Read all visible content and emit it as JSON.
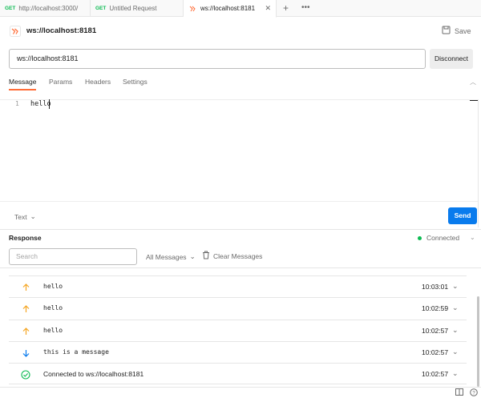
{
  "tabs": [
    {
      "method": "GET",
      "label": "http://localhost:3000/"
    },
    {
      "method": "GET",
      "label": "Untitled Request"
    },
    {
      "method": "",
      "label": "ws://localhost:8181",
      "active": true
    }
  ],
  "header": {
    "title": "ws://localhost:8181",
    "save_label": "Save"
  },
  "url": {
    "value": "ws://localhost:8181",
    "action_label": "Disconnect"
  },
  "subtabs": [
    "Message",
    "Params",
    "Headers",
    "Settings"
  ],
  "editor": {
    "line_number": "1",
    "content": "hello",
    "format": "Text",
    "send_label": "Send"
  },
  "response": {
    "title": "Response",
    "status": "Connected",
    "search_placeholder": "Search",
    "filter_label": "All Messages",
    "clear_label": "Clear Messages",
    "messages": [
      {
        "direction": "sent",
        "text": "hello",
        "time": "10:03:01"
      },
      {
        "direction": "sent",
        "text": "hello",
        "time": "10:02:59"
      },
      {
        "direction": "sent",
        "text": "hello",
        "time": "10:02:57"
      },
      {
        "direction": "received",
        "text": "this is a message",
        "time": "10:02:57"
      },
      {
        "direction": "connected",
        "text": "Connected to ws://localhost:8181",
        "time": "10:02:57"
      }
    ]
  },
  "colors": {
    "accent": "#ff6c37",
    "primary": "#097bed",
    "success": "#0cbb52",
    "sent": "#f5a623",
    "received": "#097bed"
  }
}
